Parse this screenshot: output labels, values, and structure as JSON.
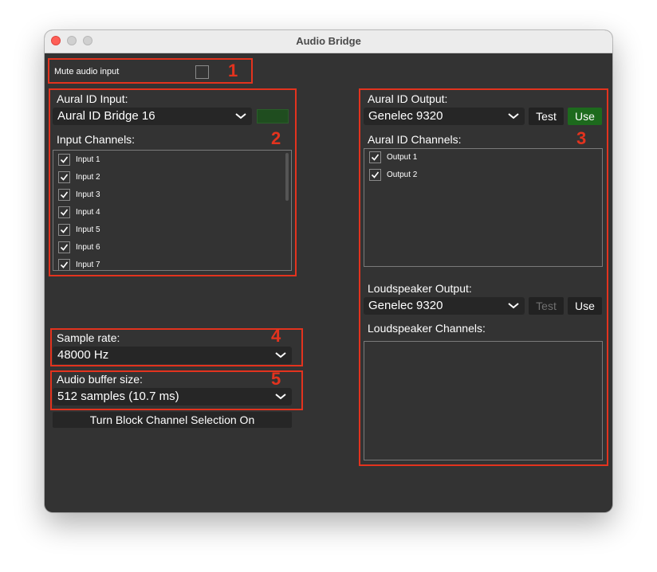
{
  "window": {
    "title": "Audio Bridge"
  },
  "mute": {
    "label": "Mute audio input",
    "checked": false
  },
  "input": {
    "label": "Aural ID Input:",
    "device": "Aural ID Bridge 16",
    "channels_label": "Input Channels:",
    "channels": [
      "Input 1",
      "Input 2",
      "Input 3",
      "Input 4",
      "Input 5",
      "Input 6",
      "Input 7"
    ]
  },
  "output": {
    "label": "Aural ID Output:",
    "device": "Genelec 9320",
    "test_label": "Test",
    "use_label": "Use",
    "channels_label": "Aural ID Channels:",
    "channels": [
      "Output 1",
      "Output 2"
    ]
  },
  "loudspeaker": {
    "label": "Loudspeaker Output:",
    "device": "Genelec 9320",
    "test_label": "Test",
    "use_label": "Use",
    "channels_label": "Loudspeaker Channels:"
  },
  "sample_rate": {
    "label": "Sample rate:",
    "value": "48000 Hz"
  },
  "buffer": {
    "label": "Audio buffer size:",
    "value": "512 samples (10.7 ms)"
  },
  "block_button": {
    "label": "Turn Block Channel Selection On"
  },
  "annotations": [
    "1",
    "2",
    "3",
    "4",
    "5"
  ],
  "colors": {
    "annotation": "#e3331e",
    "use_active": "#1d6a1d",
    "background": "#333333"
  },
  "icons": [
    "chevron-down-icon",
    "checkmark-icon",
    "level-meter"
  ]
}
